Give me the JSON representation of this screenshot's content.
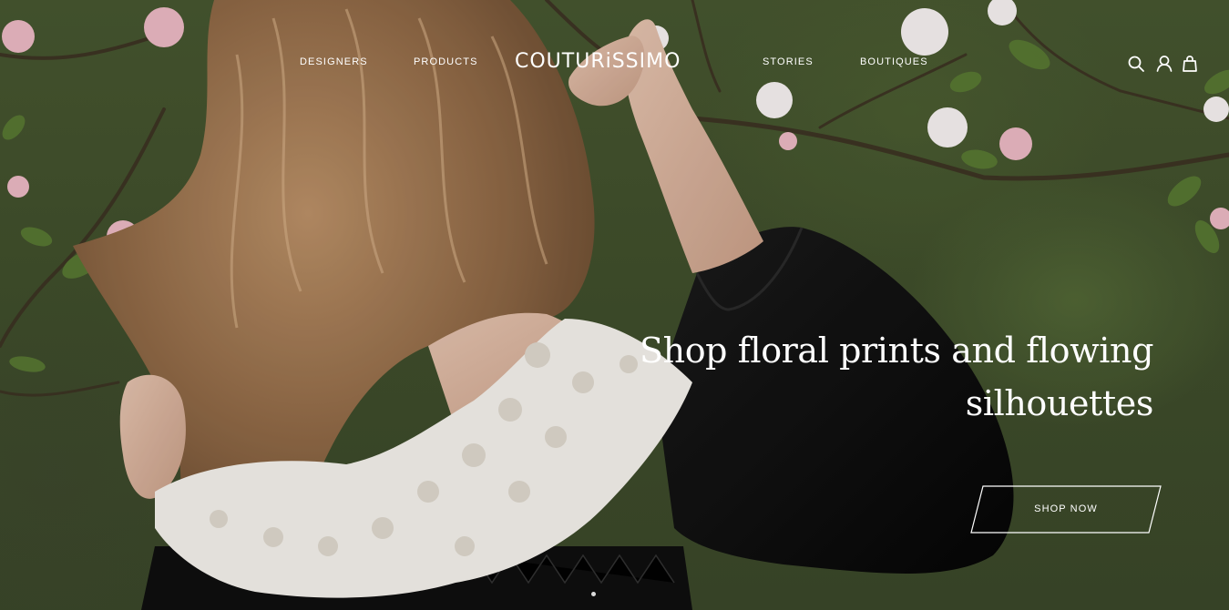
{
  "brand": {
    "logo_text": "COUTURiSSIMO"
  },
  "nav": {
    "left": [
      {
        "label": "DESIGNERS"
      },
      {
        "label": "PRODUCTS"
      }
    ],
    "right": [
      {
        "label": "STORIES"
      },
      {
        "label": "BOUTIQUES"
      }
    ],
    "icons": [
      "search-icon",
      "account-icon",
      "shopping-bag-icon"
    ]
  },
  "hero": {
    "headline_line1": "Shop floral prints and flowing",
    "headline_line2": "silhouettes",
    "cta_label": "SHOP NOW",
    "image_subject": "woman with long wavy hair in black blouse with white floral lace collar among blossoming apple branches"
  },
  "carousel": {
    "slide_count": 1,
    "active_index": 0
  },
  "colors": {
    "text": "#ffffff",
    "background_green": "#3f4e2b",
    "blouse_black": "#0d0d0d",
    "lace_white": "#f2efe9",
    "blossom_pink": "#e9b7c2"
  }
}
